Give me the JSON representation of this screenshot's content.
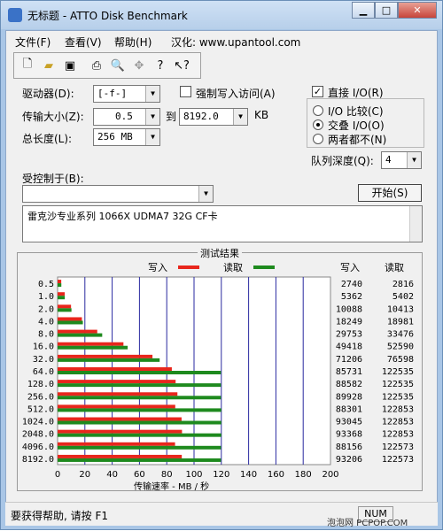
{
  "window": {
    "title": "无标题 - ATTO Disk Benchmark"
  },
  "menu": [
    "文件(F)",
    "查看(V)",
    "帮助(H)",
    "汉化: www.upantool.com"
  ],
  "toolbar": {
    "icons": [
      "new-file-icon",
      "open-folder-icon",
      "save-icon",
      "print-icon",
      "print-preview-icon",
      "move-icon",
      "help-icon",
      "context-help-icon"
    ]
  },
  "form": {
    "drive_label": "驱动器(D):",
    "drive_value": "[-f-]",
    "force_write_label": "强制写入访问(A)",
    "transfer_size_label": "传输大小(Z):",
    "transfer_from": "0.5",
    "to_label": "到",
    "transfer_to": "8192.0",
    "kb_label": "KB",
    "total_length_label": "总长度(L):",
    "total_length_value": "256 MB",
    "direct_io_label": "直接 I/O(R)",
    "io_compare_label": "I/O 比较(C)",
    "overlap_io_label": "交叠 I/O(O)",
    "neither_label": "两者都不(N)",
    "queue_depth_label": "队列深度(Q):",
    "queue_depth_value": "4",
    "controlled_by_label": "受控制于(B):",
    "controlled_by_value": "",
    "start_label": "开始(S)",
    "description": "雷克沙专业系列 1066X UDMA7 32G CF卡"
  },
  "results": {
    "title": "测试结果",
    "write_label": "写入",
    "read_label": "读取",
    "col_write": "写入",
    "col_read": "读取",
    "x_axis_label": "传输速率 - MB / 秒"
  },
  "status": {
    "text": "要获得帮助, 请按 F1",
    "num": "NUM"
  },
  "watermark": "泡泡网 PCPOP.COM",
  "colors": {
    "write": "#e8261c",
    "read": "#1e8a1e",
    "grid": "#2a2aa0"
  },
  "chart_data": {
    "type": "bar",
    "orientation": "horizontal",
    "title": "测试结果",
    "xlabel": "传输速率 - MB / 秒",
    "xlim": [
      0,
      200
    ],
    "x_ticks": [
      "0",
      "20",
      "40",
      "60",
      "80",
      "100",
      "120",
      "140",
      "160",
      "180",
      "200"
    ],
    "categories": [
      "0.5",
      "1.0",
      "2.0",
      "4.0",
      "8.0",
      "16.0",
      "32.0",
      "64.0",
      "128.0",
      "256.0",
      "512.0",
      "1024.0",
      "2048.0",
      "4096.0",
      "8192.0"
    ],
    "series": [
      {
        "name": "写入",
        "values": [
          2740,
          5362,
          10088,
          18249,
          29753,
          49418,
          71206,
          85731,
          88582,
          89928,
          88301,
          93045,
          93368,
          88156,
          93206
        ]
      },
      {
        "name": "读取",
        "values": [
          2816,
          5402,
          10413,
          18981,
          33476,
          52590,
          76598,
          122535,
          122535,
          122535,
          122853,
          122853,
          122853,
          122573,
          122573
        ]
      }
    ],
    "grid": true,
    "legend": "top"
  }
}
